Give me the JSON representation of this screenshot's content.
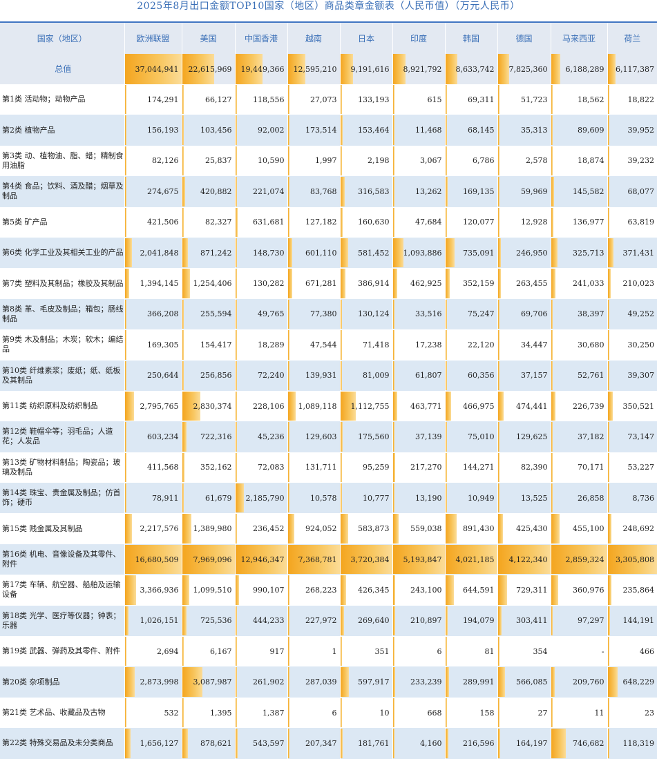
{
  "title": "2025年8月出口金额TOP10国家（地区）商品类章金额表（人民币值）（万元人民币）",
  "header": {
    "category_label": "国家（地区）",
    "countries": [
      "欧洲联盟",
      "美国",
      "中国香港",
      "越南",
      "日本",
      "印度",
      "韩国",
      "德国",
      "马来西亚",
      "荷兰"
    ]
  },
  "bar_color": "#f4a51f",
  "total": {
    "label": "总值",
    "values": [
      "37,044,941",
      "22,615,969",
      "19,449,366",
      "12,595,210",
      "9,191,616",
      "8,921,792",
      "8,633,742",
      "7,825,360",
      "6,188,289",
      "6,117,387"
    ]
  },
  "rows": [
    {
      "label": "第1类 活动物；动物产品",
      "values": [
        "174,291",
        "66,127",
        "118,556",
        "27,073",
        "133,193",
        "615",
        "69,311",
        "51,723",
        "18,562",
        "18,822"
      ]
    },
    {
      "label": "第2类 植物产品",
      "values": [
        "156,193",
        "103,456",
        "92,002",
        "173,514",
        "153,464",
        "11,468",
        "68,145",
        "35,313",
        "89,609",
        "39,952"
      ]
    },
    {
      "label": "第3类 动、植物油、脂、蜡；精制食用油脂",
      "values": [
        "82,126",
        "25,837",
        "10,590",
        "1,997",
        "2,198",
        "3,067",
        "6,786",
        "2,578",
        "18,874",
        "39,232"
      ]
    },
    {
      "label": "第4类 食品；饮料、酒及醋；烟草及制品",
      "values": [
        "274,675",
        "420,882",
        "221,074",
        "83,768",
        "316,583",
        "13,262",
        "169,135",
        "59,969",
        "145,582",
        "68,077"
      ]
    },
    {
      "label": "第5类 矿产品",
      "values": [
        "421,506",
        "82,327",
        "631,681",
        "127,182",
        "160,630",
        "47,684",
        "120,077",
        "12,928",
        "136,977",
        "63,819"
      ]
    },
    {
      "label": "第6类 化学工业及其相关工业的产品",
      "values": [
        "2,041,848",
        "871,242",
        "148,730",
        "601,110",
        "581,452",
        "1,093,886",
        "735,091",
        "246,950",
        "325,713",
        "371,431"
      ]
    },
    {
      "label": "第7类 塑料及其制品；橡胶及其制品",
      "values": [
        "1,394,145",
        "1,254,406",
        "130,282",
        "671,281",
        "386,914",
        "462,925",
        "352,159",
        "263,455",
        "241,033",
        "210,023"
      ]
    },
    {
      "label": "第8类 革、毛皮及制品；箱包；肠线制品",
      "values": [
        "366,208",
        "255,594",
        "49,765",
        "77,380",
        "130,124",
        "33,516",
        "75,247",
        "69,706",
        "38,397",
        "49,252"
      ]
    },
    {
      "label": "第9类 木及制品；木炭；软木；编结品",
      "values": [
        "169,305",
        "154,417",
        "18,289",
        "47,544",
        "71,418",
        "17,238",
        "22,120",
        "34,447",
        "30,680",
        "30,250"
      ]
    },
    {
      "label": "第10类 纤维素浆；废纸；纸、纸板及其制品",
      "values": [
        "250,644",
        "256,856",
        "72,240",
        "139,931",
        "81,009",
        "61,807",
        "60,356",
        "37,157",
        "52,761",
        "39,307"
      ]
    },
    {
      "label": "第11类 纺织原料及纺织制品",
      "values": [
        "2,795,765",
        "2,830,374",
        "228,106",
        "1,089,118",
        "1,112,755",
        "463,771",
        "466,975",
        "474,441",
        "226,739",
        "350,521"
      ]
    },
    {
      "label": "第12类 鞋帽伞等；羽毛品；人造花；人发品",
      "values": [
        "603,234",
        "722,316",
        "45,236",
        "129,603",
        "175,560",
        "37,139",
        "75,010",
        "129,625",
        "37,182",
        "73,147"
      ]
    },
    {
      "label": "第13类 矿物材料制品；陶瓷品；玻璃及制品",
      "values": [
        "411,568",
        "352,162",
        "72,083",
        "131,711",
        "95,259",
        "217,270",
        "144,271",
        "82,390",
        "70,171",
        "53,227"
      ]
    },
    {
      "label": "第14类 珠宝、贵金属及制品；仿首饰；硬币",
      "values": [
        "78,911",
        "61,679",
        "2,185,790",
        "10,578",
        "10,777",
        "13,190",
        "10,949",
        "13,525",
        "26,858",
        "8,736"
      ]
    },
    {
      "label": "第15类 贱金属及其制品",
      "values": [
        "2,217,576",
        "1,389,980",
        "236,452",
        "924,052",
        "583,873",
        "559,038",
        "891,430",
        "425,430",
        "455,100",
        "248,692"
      ]
    },
    {
      "label": "第16类 机电、音像设备及其零件、附件",
      "values": [
        "16,680,509",
        "7,969,096",
        "12,946,347",
        "7,368,781",
        "3,720,384",
        "5,193,847",
        "4,021,185",
        "4,122,340",
        "2,859,324",
        "3,305,808"
      ]
    },
    {
      "label": "第17类 车辆、航空器、船舶及运输设备",
      "values": [
        "3,366,936",
        "1,099,510",
        "990,107",
        "268,223",
        "426,345",
        "243,100",
        "644,591",
        "729,311",
        "360,976",
        "235,864"
      ]
    },
    {
      "label": "第18类 光学、医疗等仪器；钟表；乐器",
      "values": [
        "1,026,151",
        "725,536",
        "444,233",
        "227,972",
        "269,640",
        "210,897",
        "194,079",
        "303,411",
        "97,297",
        "144,191"
      ]
    },
    {
      "label": "第19类 武器、弹药及其零件、附件",
      "values": [
        "2,694",
        "6,167",
        "917",
        "1",
        "351",
        "6",
        "81",
        "354",
        "-",
        "466"
      ]
    },
    {
      "label": "第20类 杂项制品",
      "values": [
        "2,873,998",
        "3,087,987",
        "261,902",
        "287,039",
        "597,917",
        "233,239",
        "289,991",
        "566,085",
        "209,760",
        "648,229"
      ]
    },
    {
      "label": "第21类 艺术品、收藏品及古物",
      "values": [
        "532",
        "1,395",
        "1,387",
        "6",
        "10",
        "668",
        "158",
        "27",
        "11",
        "23"
      ]
    },
    {
      "label": "第22类 特殊交易品及未分类商品",
      "values": [
        "1,656,127",
        "878,621",
        "543,597",
        "207,347",
        "181,761",
        "4,160",
        "216,596",
        "164,197",
        "746,682",
        "118,319"
      ]
    }
  ]
}
